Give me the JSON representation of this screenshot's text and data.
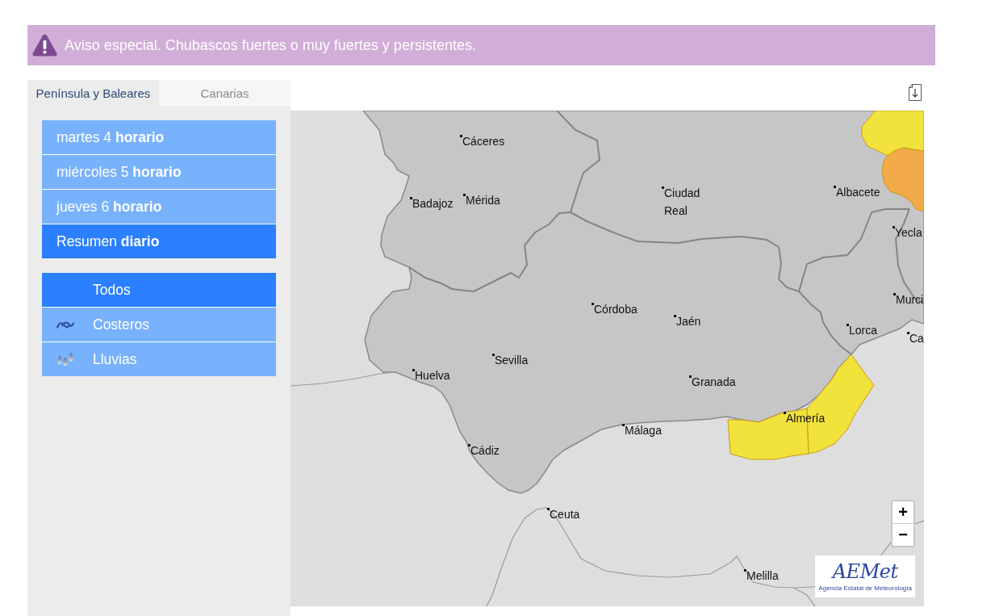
{
  "alert": {
    "text": "Aviso especial. Chubascos fuertes o muy fuertes y persistentes."
  },
  "region_tabs": [
    {
      "label": "Península y Baleares",
      "selected": true
    },
    {
      "label": "Canarias",
      "selected": false
    }
  ],
  "days": [
    {
      "label": "martes 4 **horario**",
      "selected": false
    },
    {
      "label": "miércoles 5 **horario**",
      "selected": false
    },
    {
      "label": "jueves 6 **horario**",
      "selected": false
    },
    {
      "label": "Resumen **diario**",
      "selected": true
    }
  ],
  "phenomena": [
    {
      "kind": "all",
      "label": "Todos",
      "selected": true
    },
    {
      "kind": "coastal",
      "label": "Costeros",
      "selected": false
    },
    {
      "kind": "rain",
      "label": "Lluvias",
      "selected": false
    }
  ],
  "map": {
    "warning_areas": [
      {
        "color": "#f2e23c"
      },
      {
        "color": "#f3aa48"
      },
      {
        "color": "#f2e23c"
      },
      {
        "color": "#f2e23c"
      }
    ],
    "cities": [
      "Cáceres",
      "Badajoz",
      "Mérida",
      "Ciudad Real",
      "Albacete",
      "Yecla",
      "Córdoba",
      "Jaén",
      "Murci",
      "Lorca",
      "Ca",
      "Sevilla",
      "Huelva",
      "Granada",
      "Almería",
      "Málaga",
      "Cádiz",
      "Ceuta",
      "Melilla"
    ],
    "zoom_controls": [
      "+",
      "−"
    ],
    "logo": {
      "wordmark": "AEMet",
      "tagline": "Agencia Estatal de Meteorología"
    }
  }
}
